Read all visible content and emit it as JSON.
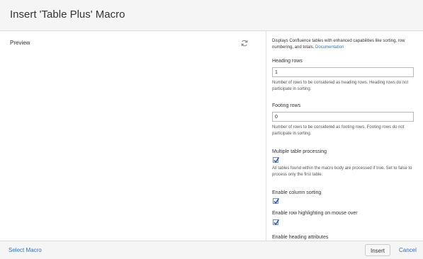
{
  "dialog": {
    "title": "Insert 'Table Plus' Macro"
  },
  "preview": {
    "label": "Preview",
    "refresh_icon": "refresh-icon"
  },
  "macro": {
    "description": "Displays Confluence tables with enhanced capabilities like sorting, row numbering, and totals.",
    "documentation_link": "Documentation"
  },
  "fields": {
    "heading_rows": {
      "label": "Heading rows",
      "value": "1",
      "help": "Number of rows to be considered as heading rows. Heading rows do not participate in sorting."
    },
    "footing_rows": {
      "label": "Footing rows",
      "value": "0",
      "help": "Number of rows to be considered as footing rows. Footing rows do not participate in sorting."
    },
    "multiple_table_processing": {
      "label": "Multiple table processing",
      "checked": true,
      "help": "All tables found within the macro body are processed if true. Set to false to process only the first table."
    },
    "enable_column_sorting": {
      "label": "Enable column sorting",
      "checked": true
    },
    "enable_row_highlighting": {
      "label": "Enable row highlighting on mouse over",
      "checked": true
    },
    "enable_heading_attributes": {
      "label": "Enable heading attributes"
    }
  },
  "footer": {
    "select_macro": "Select Macro",
    "insert": "Insert",
    "cancel": "Cancel"
  },
  "colors": {
    "link": "#3572b0",
    "header_bg": "#f5f5f5"
  }
}
